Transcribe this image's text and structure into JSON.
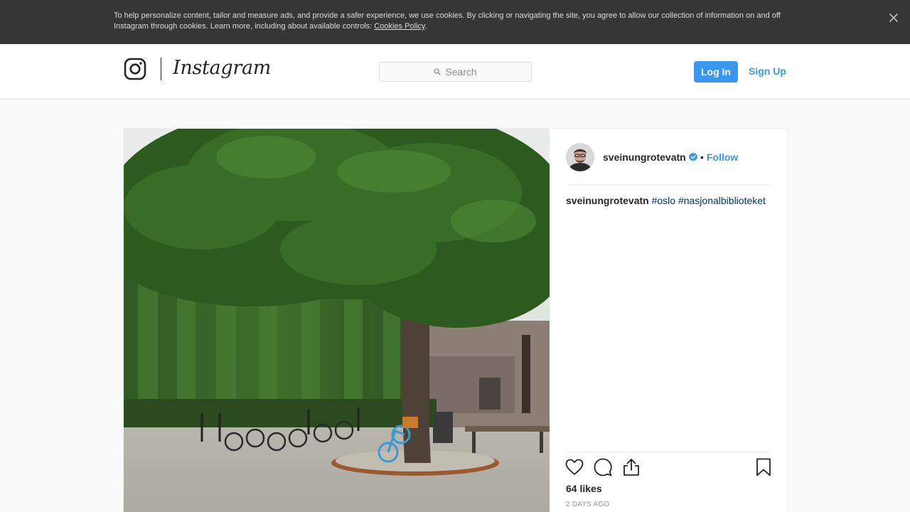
{
  "cookie_banner": {
    "text": "To help personalize content, tailor and measure ads, and provide a safer experience, we use cookies. By clicking or navigating the site, you agree to allow our collection of information on and off Instagram through cookies. Learn more, including about available controls: ",
    "link_text": "Cookies Policy",
    "after_link": "."
  },
  "nav": {
    "brand": "Instagram",
    "search_placeholder": "Search",
    "login_label": "Log In",
    "signup_label": "Sign Up"
  },
  "post": {
    "username": "sveinungrotevatn",
    "verified": true,
    "separator": "•",
    "follow_label": "Follow",
    "caption_user": "sveinungrotevatn",
    "hashtags": [
      "#oslo",
      "#nasjonalbiblioteket"
    ],
    "likes": "64 likes",
    "time": "2 DAYS AGO"
  },
  "colors": {
    "accent": "#3897f0",
    "hashtag": "#003569",
    "banner_bg": "#363636"
  },
  "icons": [
    "close-icon",
    "instagram-camera-icon",
    "search-icon",
    "verified-badge-icon",
    "heart-icon",
    "comment-icon",
    "share-icon",
    "bookmark-icon"
  ]
}
